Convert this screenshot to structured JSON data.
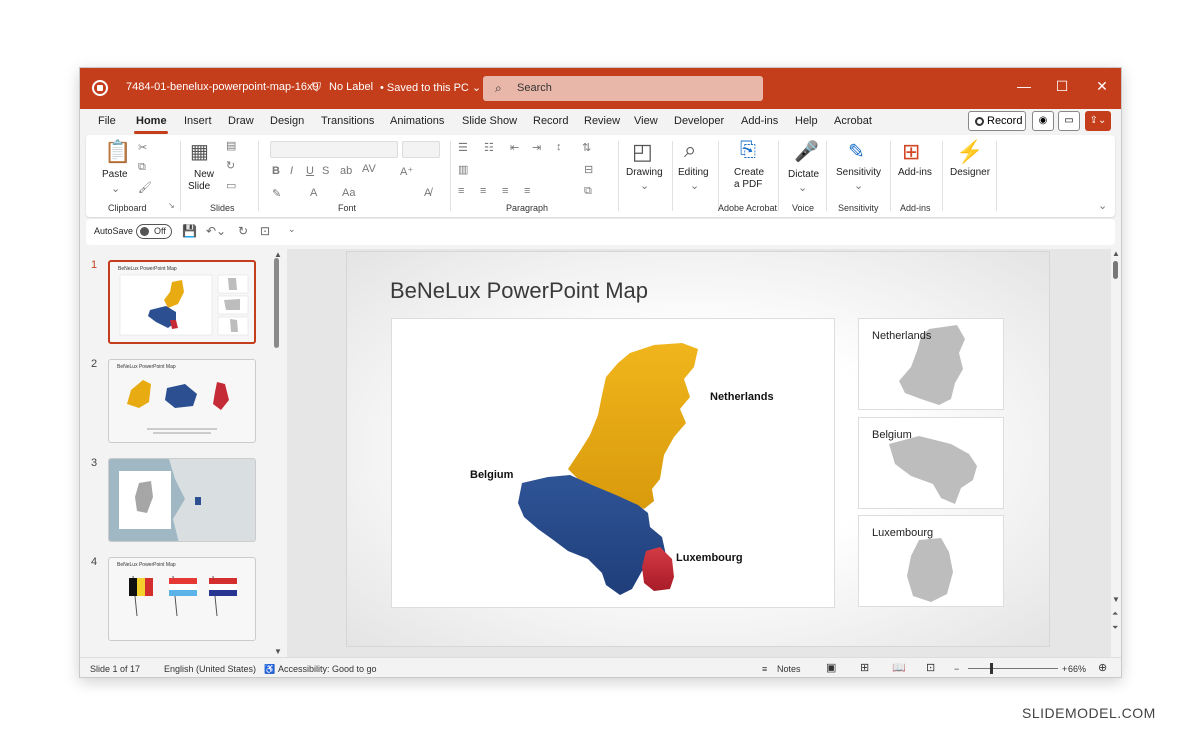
{
  "window": {
    "doc_title": "7484-01-benelux-powerpoint-map-16x9",
    "label": "No Label",
    "saved": "Saved to this PC",
    "search_placeholder": "Search"
  },
  "tabs": [
    "File",
    "Home",
    "Insert",
    "Draw",
    "Design",
    "Transitions",
    "Animations",
    "Slide Show",
    "Record",
    "Review",
    "View",
    "Developer",
    "Add-ins",
    "Help",
    "Acrobat"
  ],
  "active_tab": "Home",
  "record_label": "Record",
  "ribbon": {
    "paste": "Paste",
    "clipboard": "Clipboard",
    "new_slide_1": "New",
    "new_slide_2": "Slide",
    "slides": "Slides",
    "font": "Font",
    "paragraph": "Paragraph",
    "drawing": "Drawing",
    "editing": "Editing",
    "create_pdf_1": "Create",
    "create_pdf_2": "a PDF",
    "adobe": "Adobe Acrobat",
    "dictate": "Dictate",
    "voice": "Voice",
    "sensitivity": "Sensitivity",
    "sensitivity_group": "Sensitivity",
    "addins": "Add-ins",
    "addins_group": "Add-ins",
    "designer": "Designer"
  },
  "qat": {
    "autosave": "AutoSave",
    "toggle": "Off"
  },
  "thumbnails": [
    {
      "num": "1",
      "title": "BeNeLux PowerPoint Map",
      "active": true
    },
    {
      "num": "2",
      "title": "BeNeLux PowerPoint Map",
      "active": false
    },
    {
      "num": "3",
      "title": "",
      "active": false
    },
    {
      "num": "4",
      "title": "BeNeLux PowerPoint Map",
      "active": false
    }
  ],
  "slide": {
    "title": "BeNeLux PowerPoint Map",
    "labels": {
      "netherlands": "Netherlands",
      "belgium": "Belgium",
      "luxembourg": "Luxembourg"
    },
    "cards": [
      "Netherlands",
      "Belgium",
      "Luxembourg"
    ],
    "colors": {
      "netherlands": "#e8ac12",
      "belgium": "#2b4f90",
      "luxembourg": "#c52b36",
      "gray": "#bdbdbd"
    }
  },
  "status": {
    "slide_count": "Slide 1 of 17",
    "language": "English (United States)",
    "accessibility": "Accessibility: Good to go",
    "notes": "Notes",
    "zoom": "66%"
  },
  "watermark": "SLIDEMODEL.COM"
}
